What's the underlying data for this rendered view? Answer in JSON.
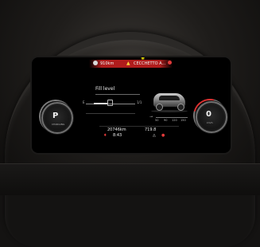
{
  "status_bar": {
    "range": "910km",
    "navigation": "CECCHETTO A..."
  },
  "center_panel": {
    "title": "Fill level",
    "gauge_empty_label": "E",
    "gauge_full_label": "1/1",
    "temp_labels": [
      "50",
      "90",
      "120",
      "150"
    ]
  },
  "info": {
    "odometer": "20746km",
    "clock": "8:43",
    "trip": "719.8"
  },
  "dials": {
    "left_letter": "P",
    "left_sub": "CHARGING",
    "right_letter": "0",
    "right_sub": "km/h"
  },
  "icons": {
    "fuel": "fuel-pump-icon",
    "warning": "warning-triangle-icon",
    "sun": "sun-icon",
    "temperature": "thermometer-icon",
    "seatbelt": "seatbelt-icon",
    "alert": "alert-bell-icon"
  },
  "colors": {
    "accent_red": "#d93030",
    "warning_yellow": "#ffd23c",
    "text": "#f0f0f0"
  }
}
